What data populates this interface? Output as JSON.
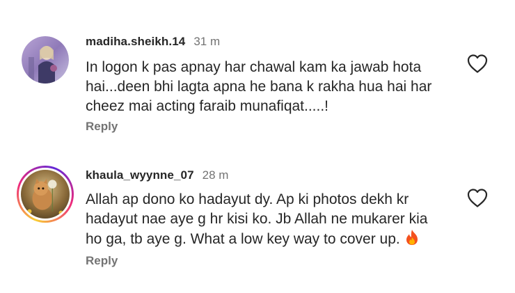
{
  "comments": [
    {
      "username": "madiha.sheikh.14",
      "time": "31 m",
      "lines": [
        "In logon k pas apnay har chawal kam ka jawab hota",
        "hai...deen bhi lagta apna he bana k rakha hua hai har",
        "cheez mai acting faraib munafiqat.....!"
      ],
      "reply_label": "Reply",
      "icons": {
        "like": "heart-outline-icon"
      }
    },
    {
      "username": "khaula_wyynne_07",
      "time": "28 m",
      "lines": [
        "Allah ap dono ko hadayut dy. Ap ki photos dekh kr",
        "hadayut nae aye g hr kisi ko. Jb Allah ne mukarer kia",
        "ho ga, tb aye g. What a  low key way to cover up."
      ],
      "emoji": "fire-emoji-icon",
      "reply_label": "Reply",
      "icons": {
        "like": "heart-outline-icon"
      },
      "avatar_story_ring": true
    }
  ],
  "colors": {
    "text": "#262626",
    "secondary": "#737373",
    "ring_gradient": [
      "#f9ce34",
      "#ee2a7b",
      "#6228d7"
    ]
  }
}
